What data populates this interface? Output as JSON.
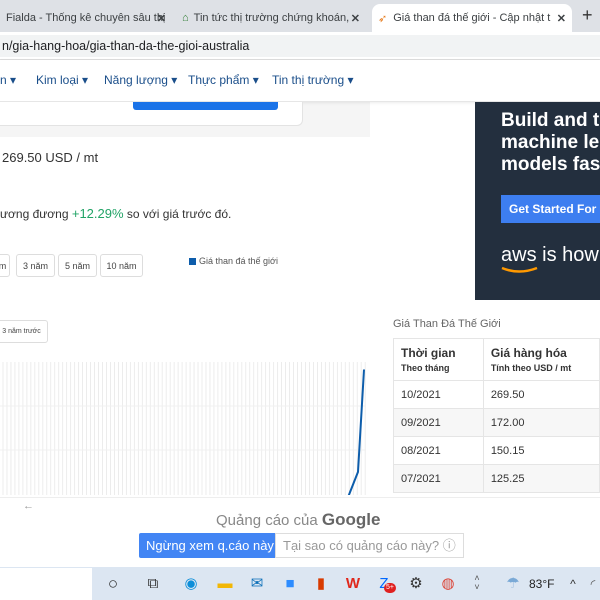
{
  "browser": {
    "tabs": [
      {
        "title": "Fialda - Thống kê chuyên sâu thị",
        "active": false
      },
      {
        "title": "Tin tức thị trường chứng khoán,",
        "active": false
      },
      {
        "title": "Giá than đá thế giới - Cập nhật t",
        "active": true
      }
    ],
    "close_glyph": "✕",
    "new_tab_glyph": "+",
    "url": "n/gia-hang-hoa/gia-than-da-the-gioi-australia"
  },
  "nav": [
    "n ▾",
    "Kim loại ▾",
    "Năng lượng ▾",
    "Thực phẩm ▾",
    "Tin thị trường ▾"
  ],
  "summary": {
    "price": "269.50 USD / mt",
    "change_prefix": "ương đương",
    "change_value": "+12.29%",
    "change_suffix": "so với giá trước đó.",
    "positive_color": "#21a366"
  },
  "range_buttons": [
    "m",
    "3 năm",
    "5 năm",
    "10 năm"
  ],
  "compare_button": "3 năm trước",
  "chart_data": {
    "type": "line",
    "series": [
      {
        "name": "Giá than đá thế giới",
        "color": "#0d5dab",
        "values": [
          125.25,
          150.15,
          172.0,
          269.5
        ]
      }
    ],
    "categories": [
      "07/2021",
      "08/2021",
      "09/2021",
      "10/2021"
    ],
    "legend": "top"
  },
  "ad": {
    "headline": [
      "Build and t",
      "machine le",
      "models fas"
    ],
    "cta": "Get Started For F",
    "brand": "aws",
    "tagline": "is how",
    "bg": "#232f3e"
  },
  "table": {
    "title": "Giá Than Đá Thế Giới",
    "headers": [
      {
        "label": "Thời gian",
        "sub": "Theo tháng"
      },
      {
        "label": "Giá hàng hóa",
        "sub": "Tính theo USD / mt"
      }
    ],
    "rows": [
      [
        "10/2021",
        "269.50"
      ],
      [
        "09/2021",
        "172.00"
      ],
      [
        "08/2021",
        "150.15"
      ],
      [
        "07/2021",
        "125.25"
      ]
    ]
  },
  "google_ad": {
    "back": "←",
    "title_prefix": "Quảng cáo của",
    "title_brand": "Google",
    "stop": "Ngừng xem q.cáo này",
    "why": "Tại sao có quảng cáo này? ⓘ"
  },
  "taskbar": {
    "weather": "83°F",
    "icons": [
      "cortana-icon",
      "task-view-icon",
      "edge-icon",
      "file-explorer-icon",
      "mail-icon",
      "zoom-icon",
      "office-icon",
      "wps-icon",
      "zalo-icon",
      "settings-icon",
      "chrome-icon"
    ],
    "zalo_badge": "5+"
  }
}
